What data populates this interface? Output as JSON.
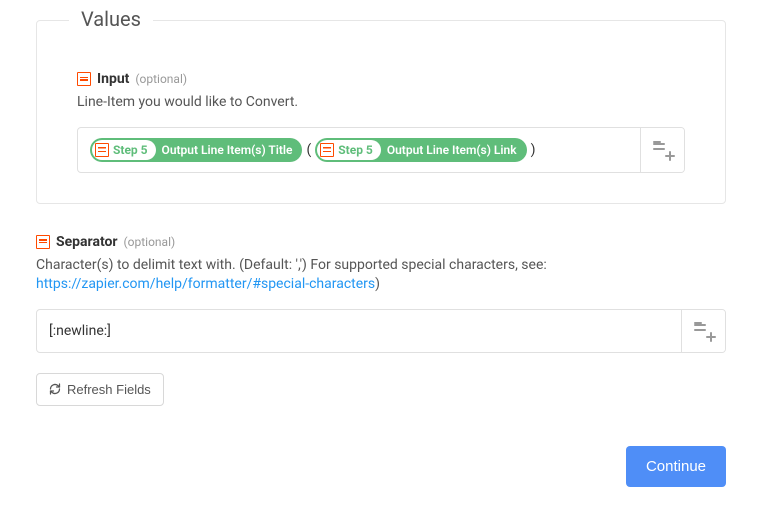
{
  "values": {
    "legend": "Values",
    "input": {
      "label": "Input",
      "optional": "(optional)",
      "description": "Line-Item you would like to Convert.",
      "pills": [
        {
          "step": "Step 5",
          "field": "Output Line Item(s) Title"
        },
        {
          "step": "Step 5",
          "field": "Output Line Item(s) Link"
        }
      ],
      "literal_open": "(",
      "literal_close": ")"
    }
  },
  "separator": {
    "label": "Separator",
    "optional": "(optional)",
    "description_prefix": "Character(s) to delimit text with. (Default: ',') For supported special characters, see: ",
    "link_text": "https://zapier.com/help/formatter/#special-characters",
    "description_suffix": ")",
    "value": "[:newline:]"
  },
  "buttons": {
    "refresh": "Refresh Fields",
    "continue": "Continue"
  }
}
